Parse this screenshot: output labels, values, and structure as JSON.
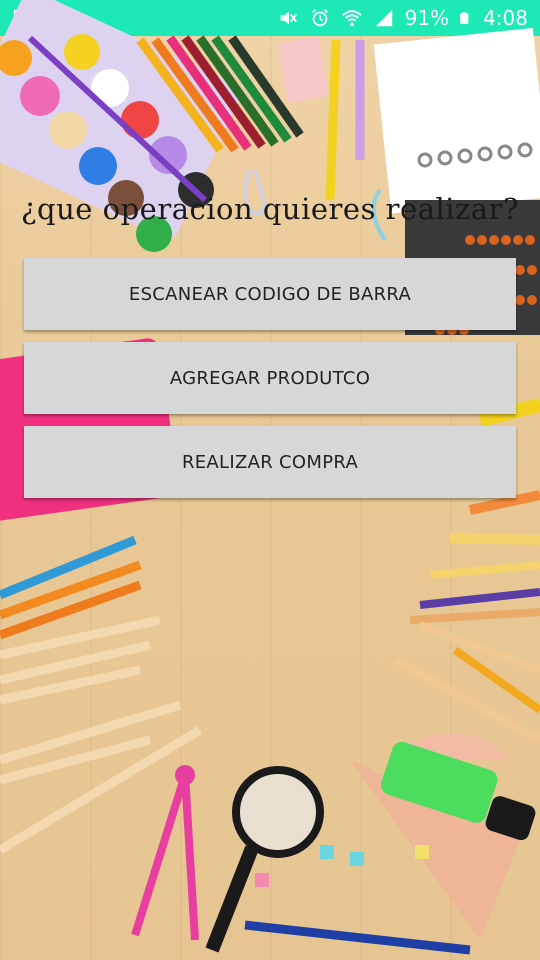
{
  "status_bar": {
    "battery_percent": "91%",
    "time": "4:08",
    "icons": [
      "image-icon",
      "voicemail-icon",
      "mute-icon",
      "alarm-icon",
      "wifi-icon",
      "signal-icon",
      "battery-icon"
    ]
  },
  "main": {
    "title": "¿que operacion quieres realizar?",
    "buttons": [
      {
        "label": "ESCANEAR CODIGO DE BARRA"
      },
      {
        "label": "AGREGAR PRODUTCO"
      },
      {
        "label": "REALIZAR COMPRA"
      }
    ]
  },
  "colors": {
    "status_bar": "#1de9b6",
    "button_bg": "#d6d7d7",
    "background_wood": "#e8c896"
  }
}
